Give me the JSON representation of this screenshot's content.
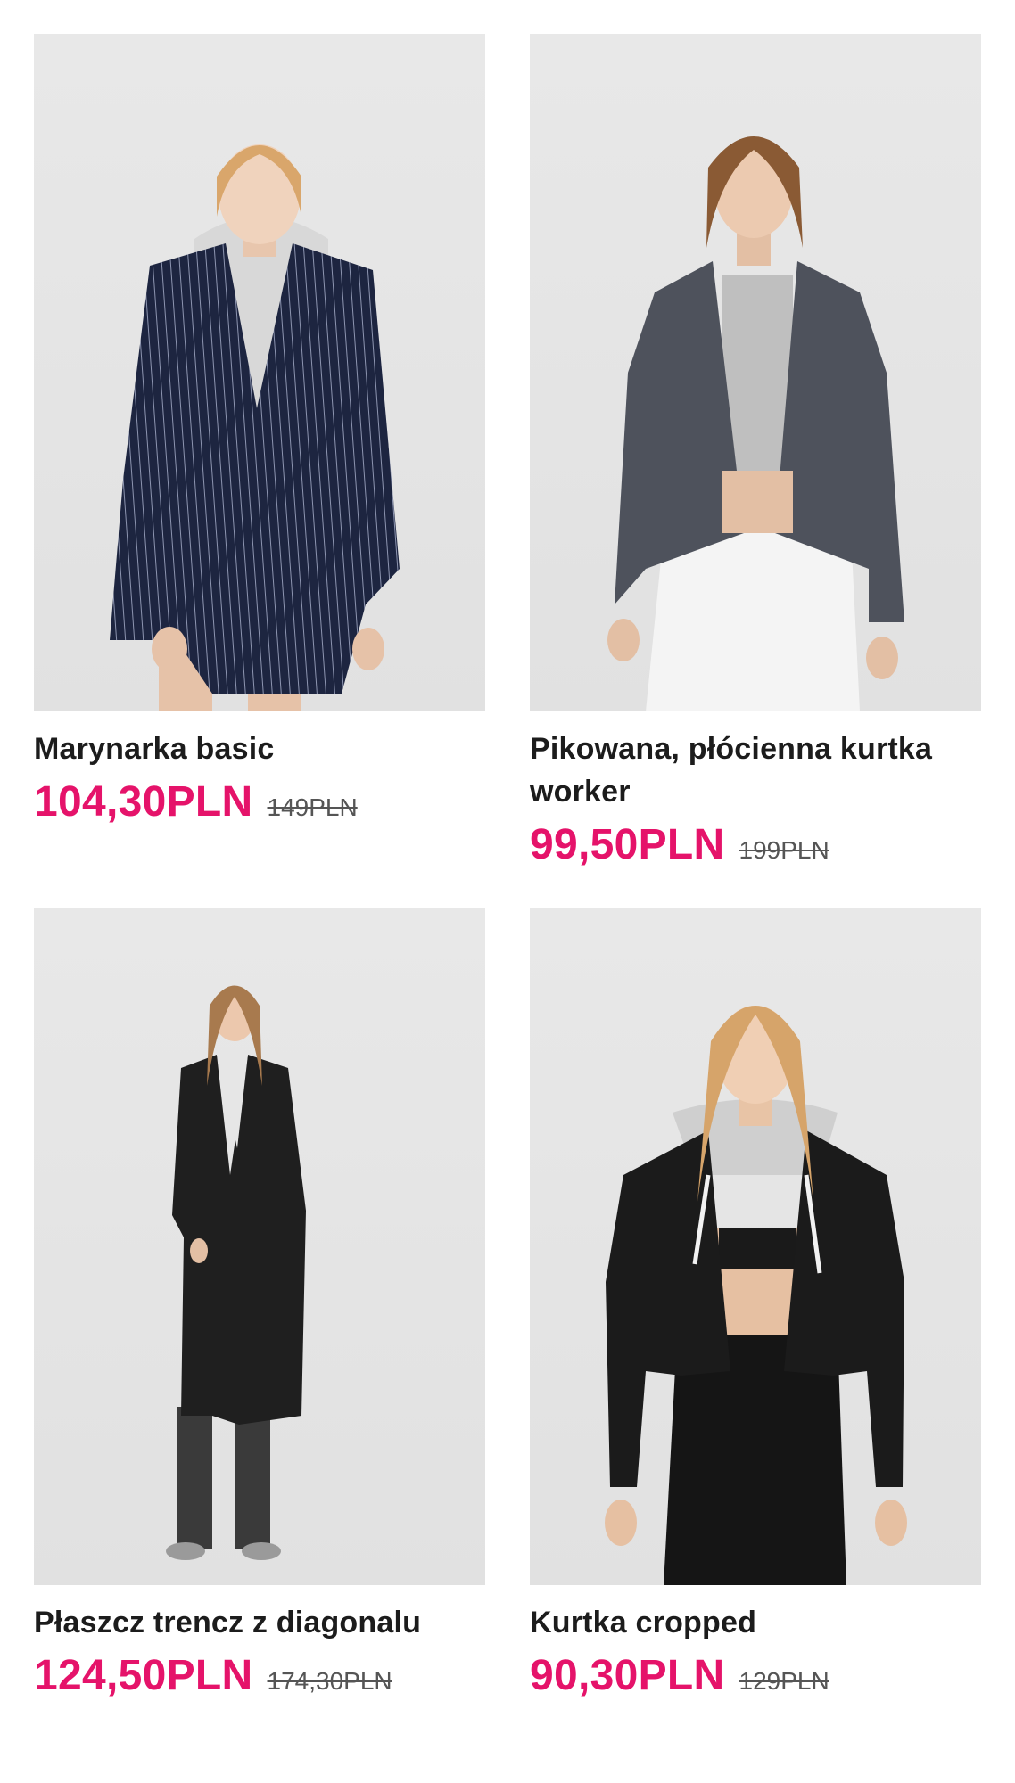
{
  "products": [
    {
      "name": "Marynarka basic",
      "price": "104,30PLN",
      "old_price": "149PLN"
    },
    {
      "name": "Pikowana, płócienna kurtka worker",
      "price": "99,50PLN",
      "old_price": "199PLN"
    },
    {
      "name": "Płaszcz trencz z diagonalu",
      "price": "124,50PLN",
      "old_price": "174,30PLN"
    },
    {
      "name": "Kurtka cropped",
      "price": "90,30PLN",
      "old_price": "129PLN"
    }
  ],
  "colors": {
    "price": "#e5136a",
    "photo_bg": "#e5e5e5"
  }
}
